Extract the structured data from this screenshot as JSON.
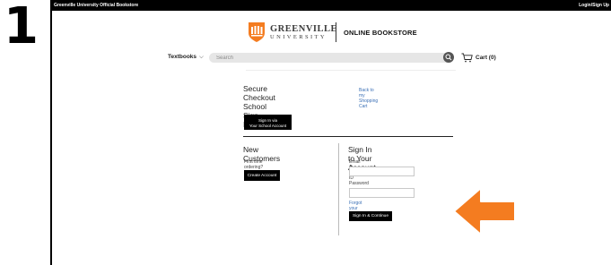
{
  "step": {
    "number": "1"
  },
  "topbar": {
    "store_name": "Greenville University Official Bookstore",
    "login_label": "Login/Sign Up"
  },
  "brand": {
    "name_line1": "GREENVILLE",
    "name_line2": "UNIVERSITY",
    "bookstore_title": "ONLINE BOOKSTORE",
    "accent_color": "#f47c20"
  },
  "nav": {
    "textbooks_label": "Textbooks",
    "search_placeholder": "Search",
    "cart_label": "Cart (0)"
  },
  "checkout": {
    "title": "Secure Checkout",
    "back_link": "Back to my Shopping Cart",
    "school_title": "School Sign In",
    "school_button_line1": "Sign In via",
    "school_button_line2": "Your School Account",
    "new_customers_title": "New Customers",
    "first_time_text": "First time ordering?",
    "create_account_label": "Create Account",
    "signin_title": "Sign In to Your Account",
    "email_label": "Email or Student ID",
    "email_value": "",
    "password_label": "Password",
    "password_value": "",
    "forgot_link": "Forgot your password?",
    "signin_button_label": "Sign In & Continue"
  },
  "annotation": {
    "arrow_color": "#f47c20",
    "icon": "arrow-left-icon"
  }
}
